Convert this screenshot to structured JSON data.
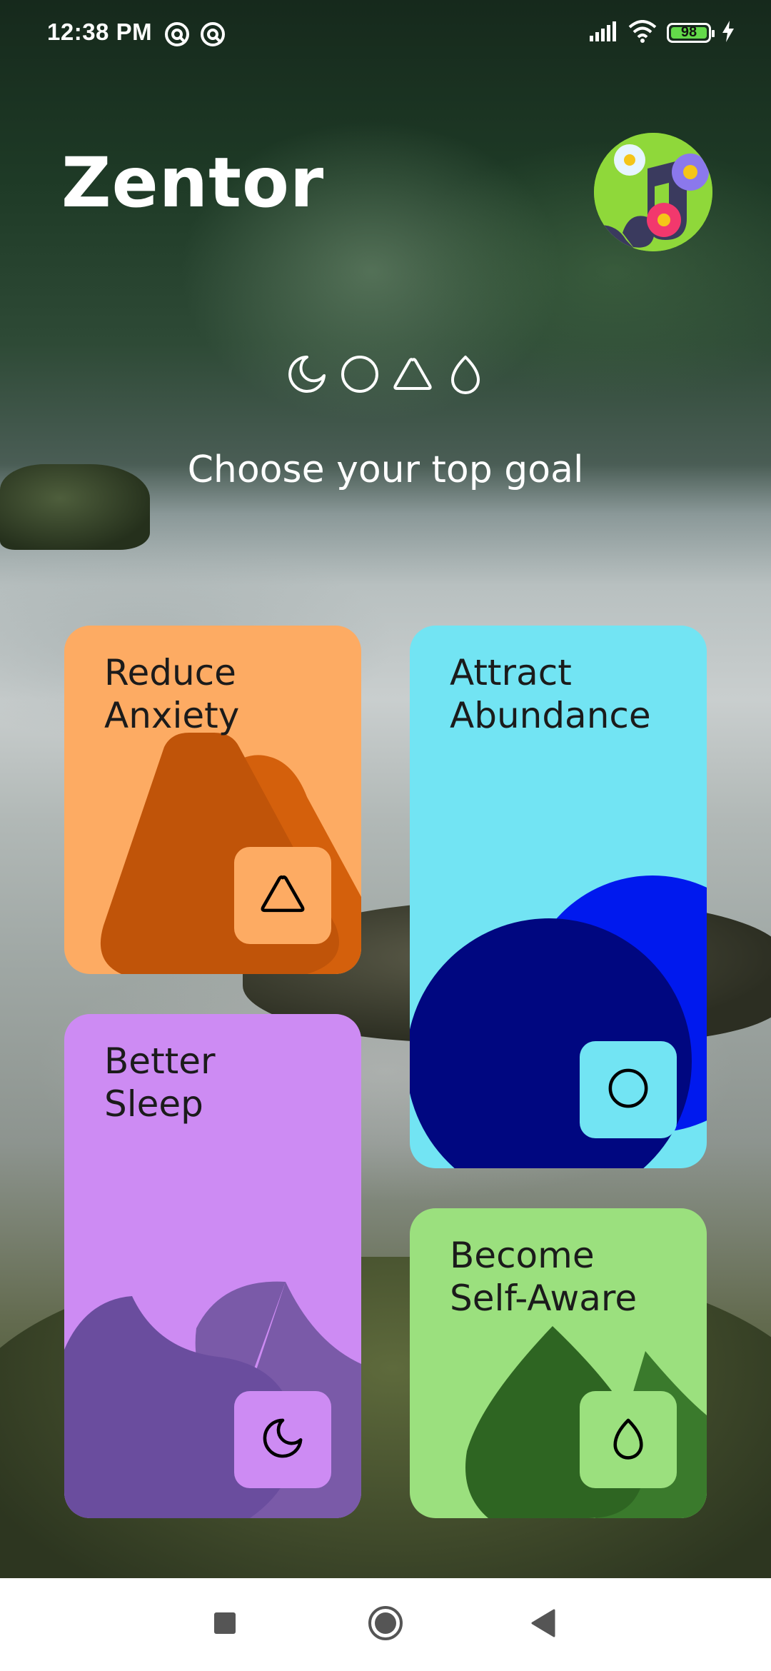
{
  "status_bar": {
    "time": "12:38 PM",
    "battery_level": "98",
    "icons": [
      "notification-icon",
      "notification-icon",
      "signal-icon",
      "wifi-icon",
      "battery-icon",
      "charging-icon"
    ]
  },
  "header": {
    "app_title": "Zentor",
    "avatar_icon": "music-note-flowers-icon"
  },
  "goal_icons": [
    "crescent-moon-icon",
    "circle-icon",
    "triangle-icon",
    "drop-icon"
  ],
  "subtitle": "Choose your top goal",
  "goals": [
    {
      "title": "Reduce\nAnxiety",
      "icon": "triangle-icon",
      "color": "#FDAB63",
      "art_colors": [
        "#C05409",
        "#D4600C"
      ],
      "badge_color": "#FDAB63"
    },
    {
      "title": "Attract\nAbundance",
      "icon": "circle-icon",
      "color": "#72E4F3",
      "art_colors": [
        "#000780",
        "#0019EE"
      ],
      "badge_color": "#72E4F3"
    },
    {
      "title": "Better\nSleep",
      "icon": "crescent-moon-icon",
      "color": "#CD8BF3",
      "art_colors": [
        "#6A4D9E",
        "#7A5AA8"
      ],
      "badge_color": "#CD8BF3"
    },
    {
      "title": "Become\nSelf-Aware",
      "icon": "drop-icon",
      "color": "#9BE07E",
      "art_colors": [
        "#2E6522",
        "#3A7A2C"
      ],
      "badge_color": "#9BE07E"
    }
  ],
  "nav_bar": {
    "buttons": [
      "recents-square-icon",
      "home-circle-icon",
      "back-triangle-icon"
    ]
  }
}
